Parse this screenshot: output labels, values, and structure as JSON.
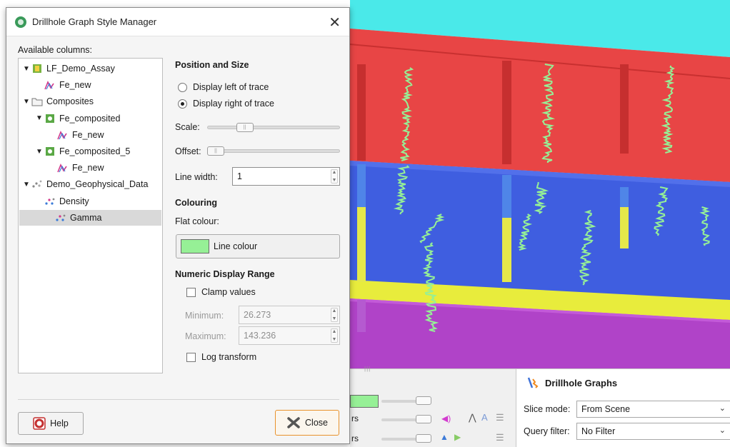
{
  "dialog": {
    "title": "Drillhole Graph Style Manager",
    "available_columns_label": "Available columns:",
    "tree": [
      {
        "label": "LF_Demo_Assay",
        "icon": "assay-table-icon",
        "level": 0,
        "expanded": true
      },
      {
        "label": "Fe_new",
        "icon": "graph-line-icon",
        "level": 1
      },
      {
        "label": "Composites",
        "icon": "folder-icon",
        "level": 0,
        "expanded": true
      },
      {
        "label": "Fe_composited",
        "icon": "composite-table-icon",
        "level": 1,
        "expanded": true
      },
      {
        "label": "Fe_new",
        "icon": "graph-line-icon",
        "level": 2
      },
      {
        "label": "Fe_composited_5",
        "icon": "composite-table-icon",
        "level": 1,
        "expanded": true
      },
      {
        "label": "Fe_new",
        "icon": "graph-line-icon",
        "level": 2
      },
      {
        "label": "Demo_Geophysical_Data",
        "icon": "geophysical-icon",
        "level": 0,
        "expanded": true
      },
      {
        "label": "Density",
        "icon": "geophysical-column-icon",
        "level": 1
      },
      {
        "label": "Gamma",
        "icon": "geophysical-column-icon",
        "level": 1,
        "selected": true
      }
    ],
    "position_size": {
      "heading": "Position and Size",
      "left_option": "Display left of trace",
      "right_option": "Display right of trace",
      "selected": "right",
      "scale_label": "Scale:",
      "scale_value": 0.25,
      "offset_label": "Offset:",
      "offset_value": 0.0,
      "line_width_label": "Line width:",
      "line_width_value": "1"
    },
    "colouring": {
      "heading": "Colouring",
      "flat_colour_label": "Flat colour:",
      "button_label": "Line colour",
      "swatch_color": "#96f096"
    },
    "numeric_range": {
      "heading": "Numeric Display Range",
      "clamp_label": "Clamp values",
      "clamp_checked": false,
      "minimum_label": "Minimum:",
      "minimum_value": "26.273",
      "maximum_label": "Maximum:",
      "maximum_value": "143.236",
      "log_label": "Log transform",
      "log_checked": false
    },
    "help_button": "Help",
    "close_button": "Close"
  },
  "properties_panel": {
    "title": "Drillhole Graphs",
    "slice_mode_label": "Slice mode:",
    "slice_mode_value": "From Scene",
    "query_filter_label": "Query filter:",
    "query_filter_value": "No Filter"
  },
  "colors": {
    "trace_green": "#96f096",
    "layer_red": "#e84545",
    "layer_blue": "#3f5ee0",
    "layer_yellow": "#e8ec3c",
    "layer_magenta": "#b043c8",
    "sky_cyan": "#4ae9e9",
    "accent_orange": "#e8922c"
  }
}
